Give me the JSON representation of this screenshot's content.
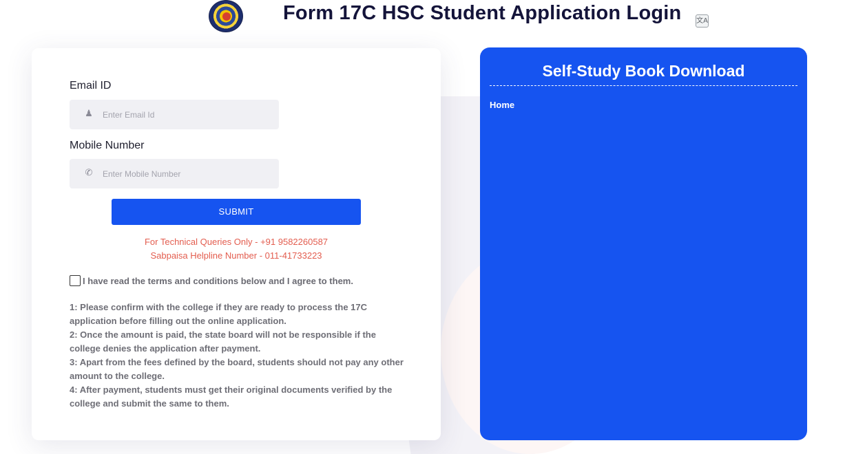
{
  "header": {
    "title": "Form 17C HSC Student Application Login",
    "logo_icon": "board-seal-logo",
    "translate_icon": "translate-icon"
  },
  "login": {
    "email_label": "Email ID",
    "email_placeholder": "Enter Email Id",
    "email_icon": "user-icon",
    "mobile_label": "Mobile Number",
    "mobile_placeholder": "Enter Mobile Number",
    "mobile_icon": "phone-icon",
    "submit_label": "SUBMIT",
    "contact_tech": "For Technical Queries Only - +91 9582260587",
    "contact_helpline": "Sabpaisa Helpline Number - 011-41733223",
    "agree_label": "I have read the terms and conditions below and I agree to them.",
    "agree_checked": false,
    "terms": [
      "1: Please confirm with the college if they are ready to process the 17C application before filling out the online application.",
      "2: Once the amount is paid, the state board will not be responsible if the college denies the application after payment.",
      "3: Apart from the fees defined by the board, students should not pay any other amount to the college.",
      "4: After payment, students must get their original documents verified by the college and submit the same to them."
    ]
  },
  "side_panel": {
    "title": "Self-Study Book Download",
    "links": [
      "Home"
    ]
  },
  "colors": {
    "accent": "#1654f0",
    "contact_text": "#e35d4f",
    "title_text": "#14143a"
  }
}
